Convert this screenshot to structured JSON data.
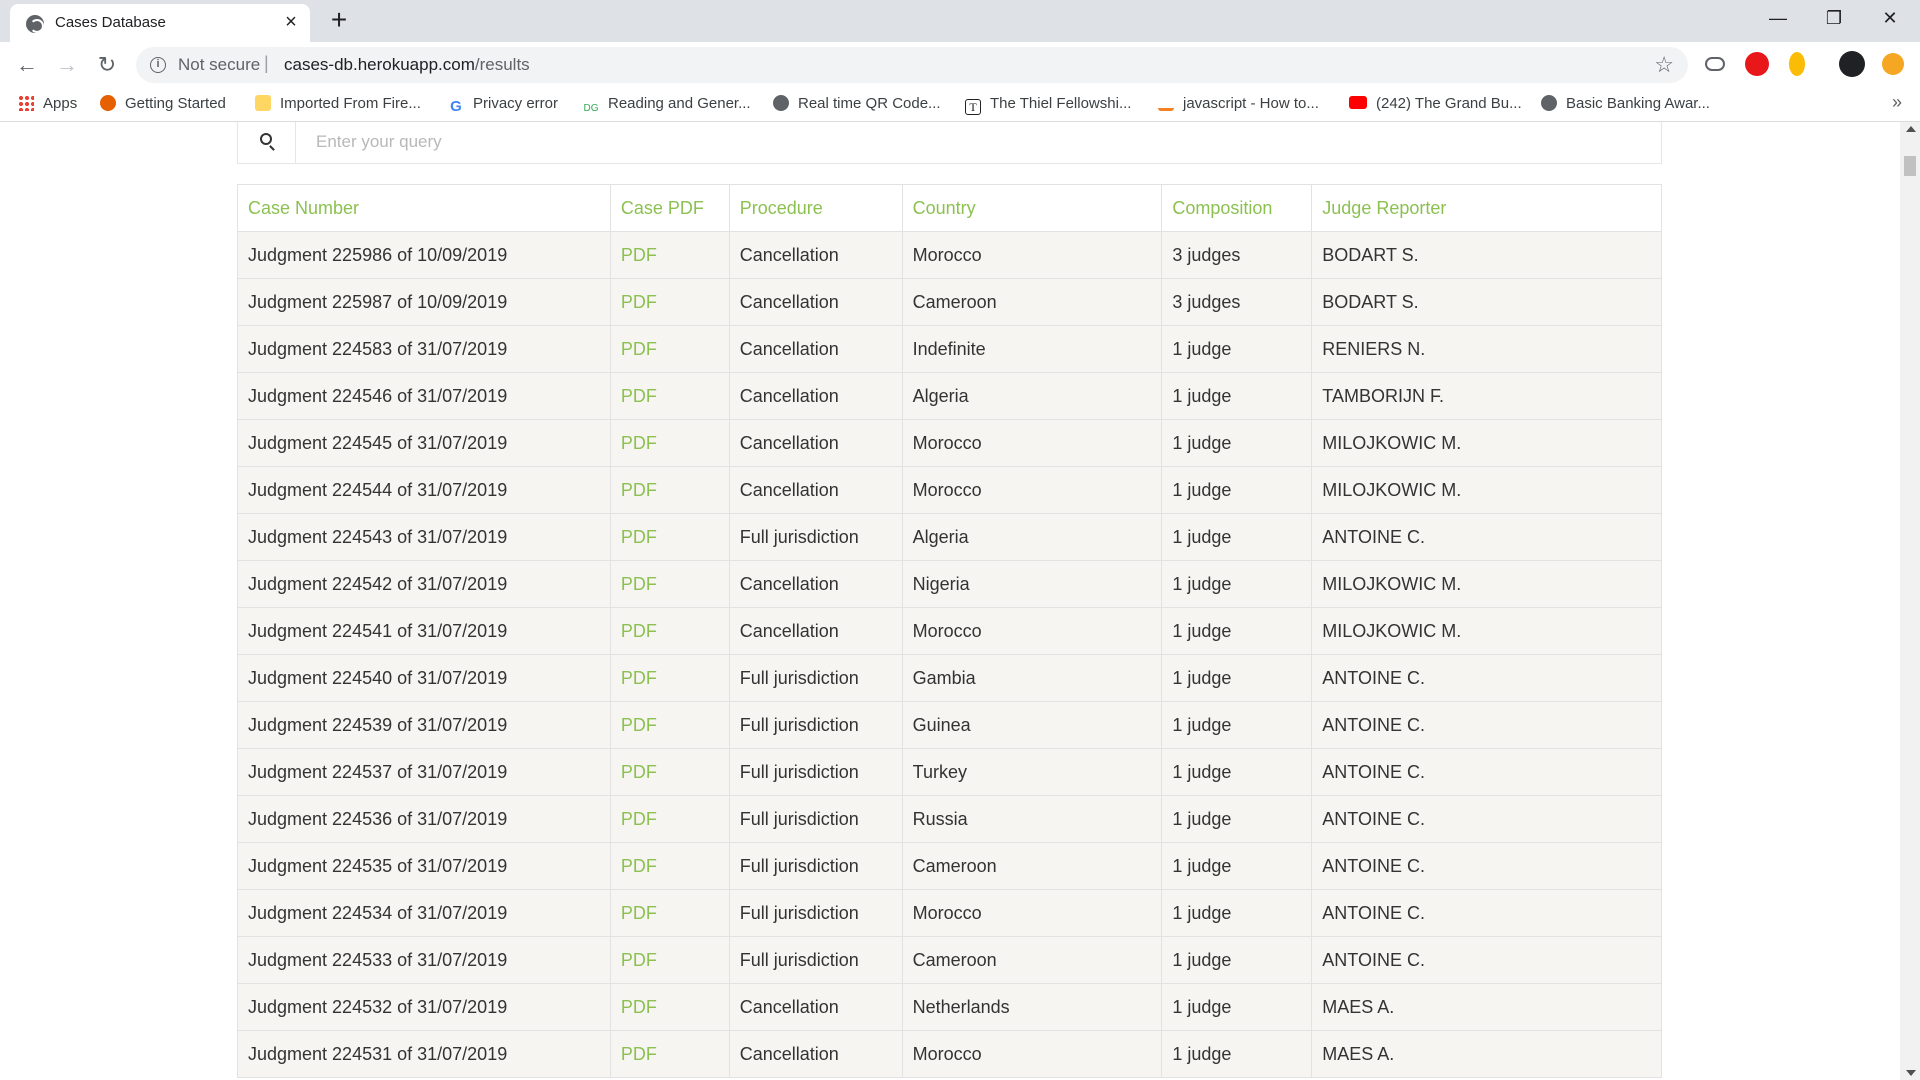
{
  "browser": {
    "tab_title": "Cases Database",
    "new_tab_label": "+",
    "not_secure": "Not secure",
    "url_host": "cases-db.herokuapp.com",
    "url_path": "/results"
  },
  "bookmarks": [
    {
      "label": "Apps",
      "icon": "apps-grid-icon",
      "color": "#ea4335"
    },
    {
      "label": "Getting Started",
      "icon": "firefox-icon",
      "color": "#e66000"
    },
    {
      "label": "Imported From Fire...",
      "icon": "folder-icon",
      "color": "#fdd663"
    },
    {
      "label": "Privacy error",
      "icon": "google-icon",
      "color": "#4285f4"
    },
    {
      "label": "Reading and Gener...",
      "icon": "dg-icon",
      "color": "#34a853"
    },
    {
      "label": "Real time QR Code...",
      "icon": "globe-icon",
      "color": "#5f6368"
    },
    {
      "label": "The Thiel Fellowshi...",
      "icon": "thiel-icon",
      "color": "#202124"
    },
    {
      "label": "javascript - How to...",
      "icon": "stackoverflow-icon",
      "color": "#f48024"
    },
    {
      "label": "(242) The Grand Bu...",
      "icon": "youtube-icon",
      "color": "#ff0000"
    },
    {
      "label": "Basic Banking Awar...",
      "icon": "globe-icon",
      "color": "#5f6368"
    }
  ],
  "search": {
    "placeholder": "Enter your query"
  },
  "table": {
    "headers": [
      "Case Number",
      "Case PDF",
      "Procedure",
      "Country",
      "Composition",
      "Judge Reporter"
    ],
    "rows": [
      [
        "Judgment 225986 of 10/09/2019",
        "PDF",
        "Cancellation",
        "Morocco",
        "3 judges",
        "BODART S."
      ],
      [
        "Judgment 225987 of 10/09/2019",
        "PDF",
        "Cancellation",
        "Cameroon",
        "3 judges",
        "BODART S."
      ],
      [
        "Judgment 224583 of 31/07/2019",
        "PDF",
        "Cancellation",
        "Indefinite",
        "1 judge",
        "RENIERS N."
      ],
      [
        "Judgment 224546 of 31/07/2019",
        "PDF",
        "Cancellation",
        "Algeria",
        "1 judge",
        "TAMBORIJN F."
      ],
      [
        "Judgment 224545 of 31/07/2019",
        "PDF",
        "Cancellation",
        "Morocco",
        "1 judge",
        "MILOJKOWIC M."
      ],
      [
        "Judgment 224544 of 31/07/2019",
        "PDF",
        "Cancellation",
        "Morocco",
        "1 judge",
        "MILOJKOWIC M."
      ],
      [
        "Judgment 224543 of 31/07/2019",
        "PDF",
        "Full jurisdiction",
        "Algeria",
        "1 judge",
        "ANTOINE C."
      ],
      [
        "Judgment 224542 of 31/07/2019",
        "PDF",
        "Cancellation",
        "Nigeria",
        "1 judge",
        "MILOJKOWIC M."
      ],
      [
        "Judgment 224541 of 31/07/2019",
        "PDF",
        "Cancellation",
        "Morocco",
        "1 judge",
        "MILOJKOWIC M."
      ],
      [
        "Judgment 224540 of 31/07/2019",
        "PDF",
        "Full jurisdiction",
        "Gambia",
        "1 judge",
        "ANTOINE C."
      ],
      [
        "Judgment 224539 of 31/07/2019",
        "PDF",
        "Full jurisdiction",
        "Guinea",
        "1 judge",
        "ANTOINE C."
      ],
      [
        "Judgment 224537 of 31/07/2019",
        "PDF",
        "Full jurisdiction",
        "Turkey",
        "1 judge",
        "ANTOINE C."
      ],
      [
        "Judgment 224536 of 31/07/2019",
        "PDF",
        "Full jurisdiction",
        "Russia",
        "1 judge",
        "ANTOINE C."
      ],
      [
        "Judgment 224535 of 31/07/2019",
        "PDF",
        "Full jurisdiction",
        "Cameroon",
        "1 judge",
        "ANTOINE C."
      ],
      [
        "Judgment 224534 of 31/07/2019",
        "PDF",
        "Full jurisdiction",
        "Morocco",
        "1 judge",
        "ANTOINE C."
      ],
      [
        "Judgment 224533 of 31/07/2019",
        "PDF",
        "Full jurisdiction",
        "Cameroon",
        "1 judge",
        "ANTOINE C."
      ],
      [
        "Judgment 224532 of 31/07/2019",
        "PDF",
        "Cancellation",
        "Netherlands",
        "1 judge",
        "MAES A."
      ],
      [
        "Judgment 224531 of 31/07/2019",
        "PDF",
        "Cancellation",
        "Morocco",
        "1 judge",
        "MAES A."
      ]
    ]
  },
  "colors": {
    "accent_green": "#8cc152",
    "row_bg": "#f7f5f1"
  }
}
